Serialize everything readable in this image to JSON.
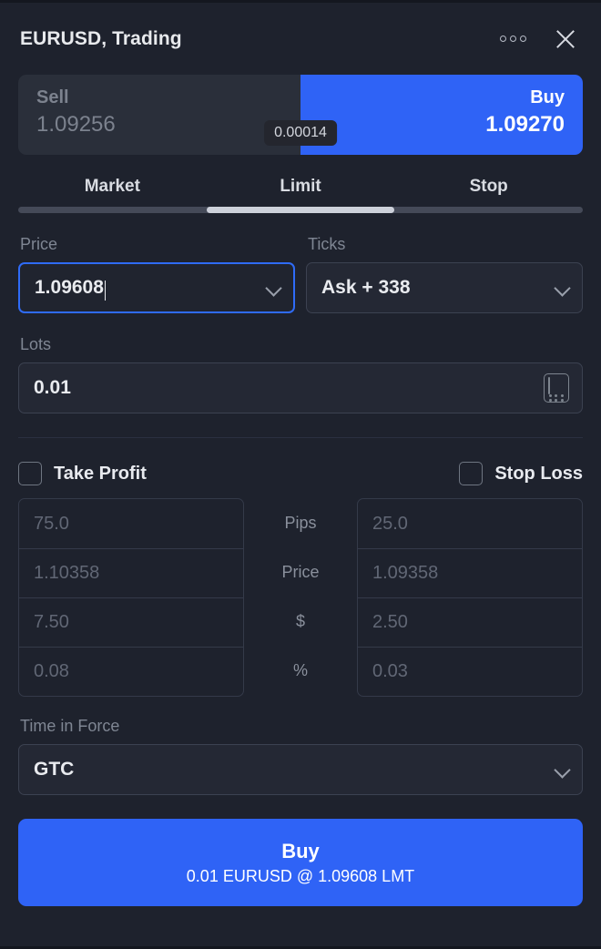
{
  "header": {
    "title": "EURUSD, Trading",
    "more_icon": "more-options-icon",
    "close_icon": "close-icon"
  },
  "quote": {
    "sell_label": "Sell",
    "sell_price": "1.09256",
    "buy_label": "Buy",
    "buy_price": "1.09270",
    "spread": "0.00014"
  },
  "order_type": {
    "tabs": [
      {
        "label": "Market",
        "active": false
      },
      {
        "label": "Limit",
        "active": true
      },
      {
        "label": "Stop",
        "active": false
      }
    ],
    "selected": "Limit"
  },
  "fields": {
    "price_label": "Price",
    "price_value": "1.09608",
    "ticks_label": "Ticks",
    "ticks_value": "Ask + 338",
    "lots_label": "Lots",
    "lots_value": "0.01",
    "calculator_icon": "calculator-icon"
  },
  "take_profit": {
    "title": "Take Profit",
    "checked": false,
    "pips": "75.0",
    "price": "1.10358",
    "dollars": "7.50",
    "percent": "0.08"
  },
  "stop_loss": {
    "title": "Stop Loss",
    "checked": false,
    "pips": "25.0",
    "price": "1.09358",
    "dollars": "2.50",
    "percent": "0.03"
  },
  "tpsl_labels": {
    "pips": "Pips",
    "price": "Price",
    "dollars": "$",
    "percent": "%"
  },
  "time_in_force": {
    "label": "Time in Force",
    "value": "GTC"
  },
  "submit": {
    "main": "Buy",
    "sub": "0.01 EURUSD @ 1.09608 LMT"
  },
  "colors": {
    "accent": "#2F63F6",
    "background": "#1E222D",
    "panel": "#2A2F3A",
    "border": "#3C4251",
    "muted_text": "#7F8693",
    "text": "#E8EAED"
  }
}
